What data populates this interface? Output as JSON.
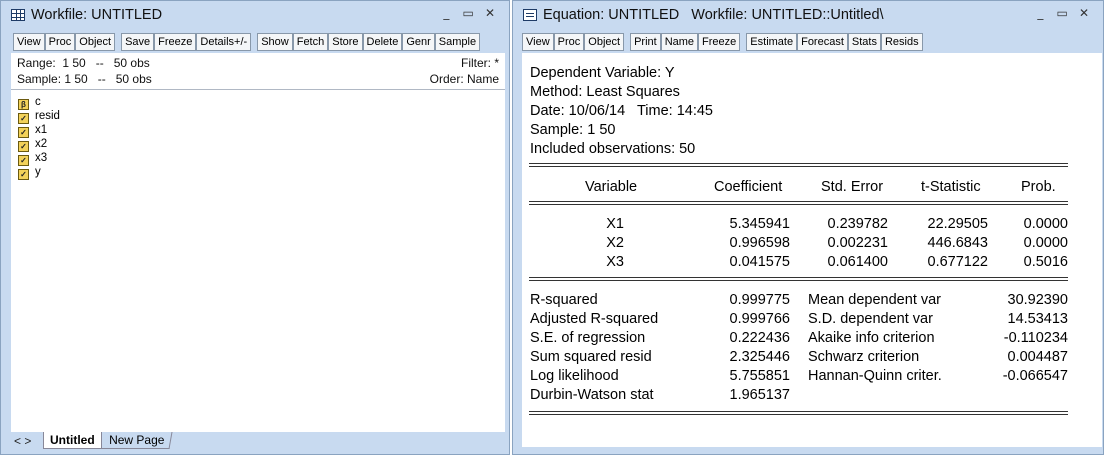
{
  "workfile_window": {
    "title": "Workfile: UNTITLED",
    "controls": [
      "_",
      "▭",
      "✕"
    ],
    "toolbar": [
      "View",
      "Proc",
      "Object",
      "Save",
      "Freeze",
      "Details+/-",
      "Show",
      "Fetch",
      "Store",
      "Delete",
      "Genr",
      "Sample"
    ],
    "range_label": "Range:  1 50   --   50 obs",
    "sample_label": "Sample: 1 50   --   50 obs",
    "filter_label": "Filter: *",
    "order_label": "Order: Name",
    "objects": [
      {
        "name": "c",
        "icon": "beta-icon",
        "glyph": "β"
      },
      {
        "name": "resid",
        "icon": "series-icon",
        "glyph": ""
      },
      {
        "name": "x1",
        "icon": "series-icon",
        "glyph": ""
      },
      {
        "name": "x2",
        "icon": "series-icon",
        "glyph": ""
      },
      {
        "name": "x3",
        "icon": "series-icon",
        "glyph": ""
      },
      {
        "name": "y",
        "icon": "series-icon",
        "glyph": ""
      }
    ],
    "tab_arrows": "< >",
    "tabs": [
      "Untitled",
      "New Page"
    ]
  },
  "equation_window": {
    "title": "Equation: UNTITLED   Workfile: UNTITLED::Untitled\\",
    "controls": [
      "_",
      "▭",
      "✕"
    ],
    "toolbar": [
      "View",
      "Proc",
      "Object",
      "Print",
      "Name",
      "Freeze",
      "Estimate",
      "Forecast",
      "Stats",
      "Resids"
    ],
    "header": {
      "dependent": "Dependent Variable: Y",
      "method": "Method: Least Squares",
      "date": "Date: 10/06/14   Time: 14:45",
      "sample": "Sample: 1 50",
      "obs": "Included observations: 50"
    },
    "columns": [
      "Variable",
      "Coefficient",
      "Std. Error",
      "t-Statistic",
      "Prob."
    ],
    "rows": [
      {
        "var": "X1",
        "coef": "5.345941",
        "se": "0.239782",
        "t": "22.29505",
        "p": "0.0000"
      },
      {
        "var": "X2",
        "coef": "0.996598",
        "se": "0.002231",
        "t": "446.6843",
        "p": "0.0000"
      },
      {
        "var": "X3",
        "coef": "0.041575",
        "se": "0.061400",
        "t": "0.677122",
        "p": "0.5016"
      }
    ],
    "stats": [
      {
        "l": "R-squared",
        "lv": "0.999775",
        "r": "Mean dependent var",
        "rv": "30.92390"
      },
      {
        "l": "Adjusted R-squared",
        "lv": "0.999766",
        "r": "S.D. dependent var",
        "rv": "14.53413"
      },
      {
        "l": "S.E. of regression",
        "lv": "0.222436",
        "r": "Akaike info criterion",
        "rv": "-0.110234"
      },
      {
        "l": "Sum squared resid",
        "lv": "2.325446",
        "r": "Schwarz criterion",
        "rv": "0.004487"
      },
      {
        "l": "Log likelihood",
        "lv": "5.755851",
        "r": "Hannan-Quinn criter.",
        "rv": "-0.066547"
      },
      {
        "l": "Durbin-Watson stat",
        "lv": "1.965137",
        "r": "",
        "rv": ""
      }
    ]
  }
}
